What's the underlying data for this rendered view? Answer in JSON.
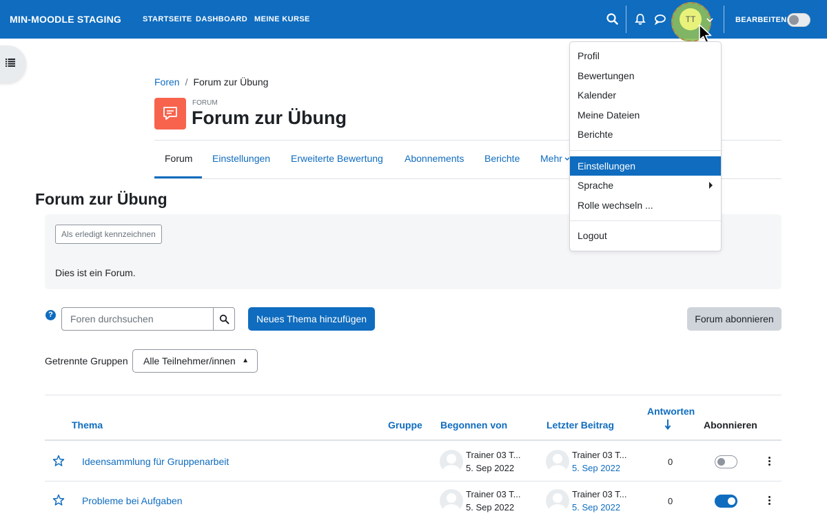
{
  "navbar": {
    "brand": "MIN-MOODLE STAGING",
    "links": [
      "STARTSEITE",
      "DASHBOARD",
      "MEINE KURSE"
    ],
    "avatar_initials": "TT",
    "edit_label": "BEARBEITEN",
    "edit_mode_on": false
  },
  "breadcrumb": {
    "parent": "Foren",
    "current": "Forum zur Übung"
  },
  "activity": {
    "type_label": "FORUM",
    "title": "Forum zur Übung"
  },
  "secondary_nav": {
    "tabs": [
      "Forum",
      "Einstellungen",
      "Erweiterte Bewertung",
      "Abonnements",
      "Berichte",
      "Mehr"
    ],
    "active": "Forum"
  },
  "page_heading": "Forum zur Übung",
  "intro": {
    "done_button": "Als erledigt kennzeichnen",
    "text": "Dies ist ein Forum."
  },
  "search": {
    "placeholder": "Foren durchsuchen"
  },
  "buttons": {
    "new_topic": "Neues Thema hinzufügen",
    "subscribe": "Forum abonnieren"
  },
  "groups": {
    "label": "Getrennte Gruppen",
    "selected": "Alle Teilnehmer/innen"
  },
  "table": {
    "headers": {
      "topic": "Thema",
      "group": "Gruppe",
      "started_by": "Begonnen von",
      "last_post": "Letzter Beitrag",
      "replies": "Antworten",
      "subscribe": "Abonnieren"
    },
    "rows": [
      {
        "topic": "Ideensammlung für Gruppenarbeit",
        "started_by": "Trainer 03 T...",
        "started_date": "5. Sep 2022",
        "last_post_by": "Trainer 03 T...",
        "last_post_date": "5. Sep 2022",
        "replies": "0",
        "subscribed": false
      },
      {
        "topic": "Probleme bei Aufgaben",
        "started_by": "Trainer 03 T...",
        "started_date": "5. Sep 2022",
        "last_post_by": "Trainer 03 T...",
        "last_post_date": "5. Sep 2022",
        "replies": "0",
        "subscribed": true
      }
    ]
  },
  "user_menu": {
    "items": [
      "Profil",
      "Bewertungen",
      "Kalender",
      "Meine Dateien",
      "Berichte"
    ],
    "items2": [
      "Einstellungen",
      "Sprache",
      "Rolle wechseln ..."
    ],
    "logout": "Logout",
    "highlighted": "Einstellungen"
  },
  "colors": {
    "primary": "#0f6cbf",
    "forum_icon": "#f7634d",
    "text": "#1d2125"
  }
}
